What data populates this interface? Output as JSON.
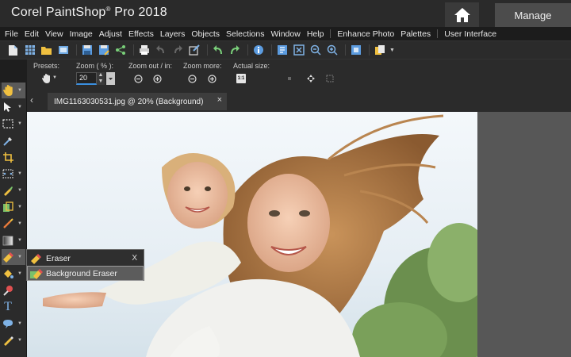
{
  "app": {
    "title": "Corel PaintShop Pro 2018",
    "title_main": "Corel",
    "title_product": "PaintShop",
    "title_registered": "®",
    "title_rest": "Pro 2018",
    "manage_label": "Manage",
    "home_icon": "home-icon"
  },
  "menu": {
    "items": [
      "File",
      "Edit",
      "View",
      "Image",
      "Adjust",
      "Effects",
      "Layers",
      "Objects",
      "Selections",
      "Window",
      "Help",
      "Enhance Photo",
      "Palettes",
      "User Interface"
    ]
  },
  "toolbar": {
    "icons": [
      "new-icon",
      "new-from-template-icon",
      "open-icon",
      "browse-icon",
      "save-icon",
      "save-as-icon",
      "share-icon",
      "print-icon",
      "undo-icon",
      "redo-icon",
      "edit-in-icon",
      "undo-history-icon",
      "redo-history-icon",
      "info-icon",
      "image-info-icon",
      "fit-window-icon",
      "zoom-out-icon",
      "zoom-in-icon",
      "full-screen-icon",
      "copy-icon"
    ]
  },
  "options": {
    "presets_label": "Presets:",
    "zoom_label": "Zoom ( % ):",
    "zoom_value": "20",
    "zoom_outin_label": "Zoom out / in:",
    "zoom_more_label": "Zoom more:",
    "actual_size_label": "Actual size:",
    "actual_size_button": "1:1"
  },
  "tab": {
    "document_title": "IMG1163030531.jpg @  20% (Background)",
    "close_label": "×",
    "back_label": "‹"
  },
  "tools": [
    {
      "name": "pan-tool",
      "icon": "hand-icon"
    },
    {
      "name": "pick-tool",
      "icon": "arrow-icon"
    },
    {
      "name": "selection-tool",
      "icon": "marquee-icon"
    },
    {
      "name": "dropper-tool",
      "icon": "eyedropper-icon"
    },
    {
      "name": "crop-tool",
      "icon": "crop-icon"
    },
    {
      "name": "straighten-tool",
      "icon": "straighten-icon"
    },
    {
      "name": "makeover-tool",
      "icon": "makeover-icon"
    },
    {
      "name": "clone-tool",
      "icon": "clone-icon"
    },
    {
      "name": "paint-brush-tool",
      "icon": "brush-icon"
    },
    {
      "name": "gradient-tool",
      "icon": "gradient-icon"
    },
    {
      "name": "eraser-tool",
      "icon": "eraser-icon"
    },
    {
      "name": "fill-tool",
      "icon": "fill-icon"
    },
    {
      "name": "color-replacer-tool",
      "icon": "color-replace-icon"
    },
    {
      "name": "text-tool",
      "icon": "text-icon"
    },
    {
      "name": "shape-tool",
      "icon": "shape-icon"
    },
    {
      "name": "pen-tool",
      "icon": "pen-icon"
    }
  ],
  "flyout": {
    "items": [
      {
        "label": "Eraser",
        "accel": "E",
        "shortcut": "X"
      },
      {
        "label": "Background Eraser",
        "accel": "B",
        "shortcut": ""
      }
    ]
  },
  "colors": {
    "titlebar": "#2a2a2a",
    "menubar": "#1c1c1c",
    "panel": "#2b2b2b",
    "workspace": "#575757",
    "accent": "#3a8fe0"
  }
}
